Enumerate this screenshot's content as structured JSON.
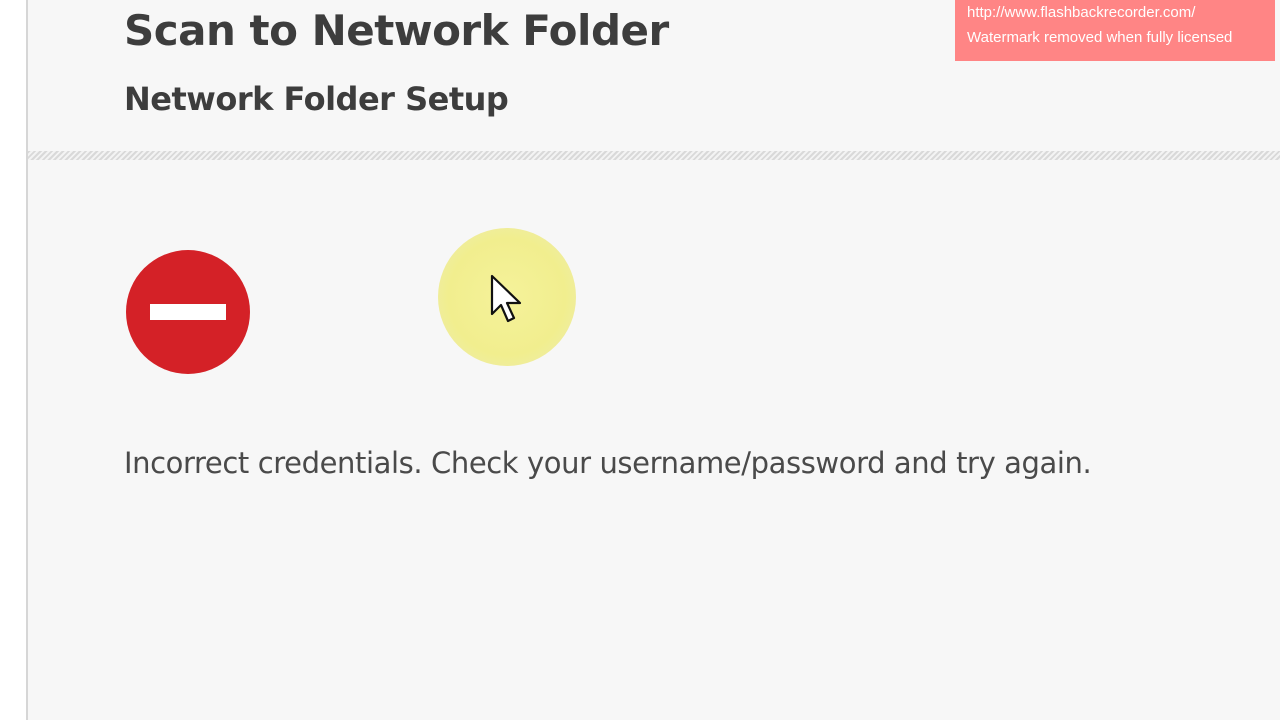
{
  "header": {
    "title": "Scan to Network Folder",
    "subtitle": "Network Folder Setup"
  },
  "status": {
    "icon": "no-entry-icon",
    "icon_color": "#d42127",
    "message": "Incorrect credentials. Check your username/password and try again."
  },
  "cursor": {
    "icon": "mouse-pointer-icon",
    "highlight_color": "#f3f08f"
  },
  "watermark": {
    "line1": "http://www.flashbackrecorder.com/",
    "line2": "Watermark removed when fully licensed",
    "background": "#ff8585"
  }
}
